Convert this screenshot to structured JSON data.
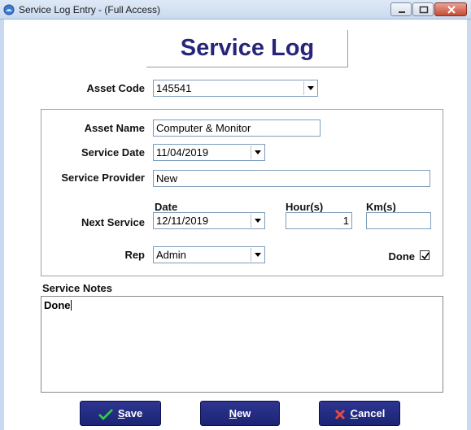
{
  "window": {
    "title": "Service Log Entry - (Full Access)"
  },
  "heading": "Service Log",
  "asset_code": {
    "label": "Asset Code",
    "value": "145541"
  },
  "asset_name": {
    "label": "Asset Name",
    "value": "Computer & Monitor"
  },
  "service_date": {
    "label": "Service Date",
    "value": "11/04/2019"
  },
  "service_provider": {
    "label": "Service Provider",
    "value": "New"
  },
  "next_service": {
    "label": "Next Service",
    "date_header": "Date",
    "hours_header": "Hour(s)",
    "km_header": "Km(s)",
    "date": "12/11/2019",
    "hours": "1",
    "km": ""
  },
  "rep": {
    "label": "Rep",
    "value": "Admin"
  },
  "done": {
    "label": "Done",
    "checked": true
  },
  "notes": {
    "label": "Service Notes",
    "value": "Done"
  },
  "buttons": {
    "save": {
      "mnemonic": "S",
      "rest": "ave"
    },
    "new": {
      "mnemonic": "N",
      "rest": "ew"
    },
    "cancel": {
      "mnemonic": "C",
      "rest": "ancel"
    }
  }
}
